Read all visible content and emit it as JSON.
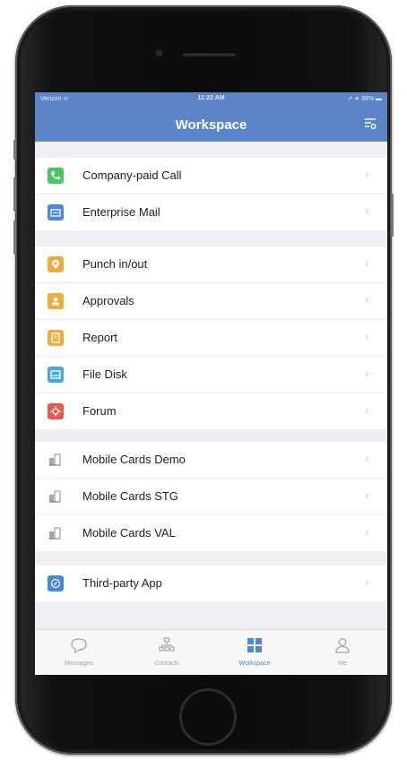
{
  "status_bar": {
    "carrier": "Verizon ᯤ",
    "time": "11:22 AM",
    "battery": "⇗ ∗ 39% ▬"
  },
  "header": {
    "title": "Workspace",
    "filter_icon": "filter-settings-icon"
  },
  "colors": {
    "header_bg": "#5b84c9",
    "green": "#4cc560",
    "blue": "#4c86de",
    "orange": "#f1ab3a",
    "teal": "#45a9dd",
    "red": "#e8584c"
  },
  "groups": [
    {
      "items": [
        {
          "label": "Company-paid Call",
          "icon": "phone-icon"
        },
        {
          "label": "Enterprise Mail",
          "icon": "mail-icon"
        }
      ]
    },
    {
      "items": [
        {
          "label": "Punch in/out",
          "icon": "location-pin-icon"
        },
        {
          "label": "Approvals",
          "icon": "person-stamp-icon"
        },
        {
          "label": "Report",
          "icon": "report-icon"
        },
        {
          "label": "File Disk",
          "icon": "disk-icon"
        },
        {
          "label": "Forum",
          "icon": "forum-icon"
        }
      ]
    },
    {
      "items": [
        {
          "label": "Mobile Cards Demo",
          "icon": "mobile-cards-icon"
        },
        {
          "label": "Mobile Cards STG",
          "icon": "mobile-cards-icon"
        },
        {
          "label": "Mobile Cards VAL",
          "icon": "mobile-cards-icon"
        }
      ]
    },
    {
      "items": [
        {
          "label": "Third-party App",
          "icon": "compass-icon"
        }
      ]
    }
  ],
  "tabs": [
    {
      "label": "Messages",
      "icon": "chat-bubble-icon",
      "active": false
    },
    {
      "label": "Contacts",
      "icon": "org-chart-icon",
      "active": false
    },
    {
      "label": "Workspace",
      "icon": "grid-icon",
      "active": true
    },
    {
      "label": "Me",
      "icon": "person-icon",
      "active": false
    }
  ]
}
